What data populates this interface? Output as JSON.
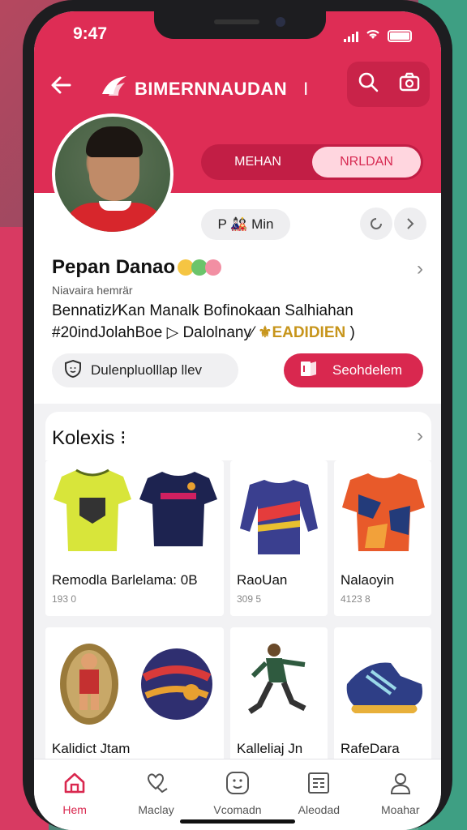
{
  "status": {
    "time": "9:47"
  },
  "navbar": {
    "brand": "BIMERNNAUDAN",
    "cursor": "I"
  },
  "tabs": [
    {
      "label": "MEHAN"
    },
    {
      "label": "NRLDAN"
    }
  ],
  "profile": {
    "action_label": "P 🎎 Min",
    "name": "Pepan Danao",
    "subtitle": "Niavaira hemrär",
    "desc_line1": "Bennatizl⁄Kan Manalk Bofinokaan Salhiahan",
    "desc_line2_prefix": "#20indJolahBoe ▷ Dalolnany⁄",
    "desc_line2_highlight": "⚜EADIDIEN",
    "desc_line2_suffix": ")",
    "secondary_button": "Dulenpluolllap llev",
    "primary_button": "Seohdelem"
  },
  "collection": {
    "title": "Kolexis ⁝",
    "row1": [
      {
        "label": "Remodla Barlelama: 0B",
        "price": "193 0"
      },
      {
        "label": "RaoUan",
        "price": "309 5"
      },
      {
        "label": "Nalaoyin",
        "price": "4123 8"
      }
    ],
    "row2": [
      {
        "label": "Kalidict Jtam"
      },
      {
        "label": "Kalleliaj Jn"
      },
      {
        "label": "RafeDara"
      }
    ]
  },
  "tabbar": [
    {
      "label": "Hem",
      "icon": "home-icon"
    },
    {
      "label": "Maclay",
      "icon": "heart-hand-icon"
    },
    {
      "label": "Vcomadn",
      "icon": "smiley-icon"
    },
    {
      "label": "Aleodad",
      "icon": "list-icon"
    },
    {
      "label": "Moahar",
      "icon": "person-icon"
    }
  ],
  "colors": {
    "accent": "#de2d55",
    "highlight": "#c7951b"
  }
}
